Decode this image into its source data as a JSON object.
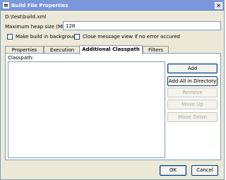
{
  "window": {
    "title": "Build File Properties",
    "close_symbol": "×"
  },
  "build_file": {
    "path": "D:\\test\\build.xml"
  },
  "heap": {
    "label": "Maximum heap size (Mb):",
    "value": "128"
  },
  "options": {
    "background_label": "Make build in background",
    "close_message_label": "Close message view if no error occured",
    "background_checked": false,
    "close_message_checked": false
  },
  "tabs": [
    {
      "label": "Properties"
    },
    {
      "label": "Execution"
    },
    {
      "label": "Additional Classpath"
    },
    {
      "label": "Filters"
    }
  ],
  "active_tab": "Additional Classpath",
  "classpath": {
    "label": "Classpath:",
    "items": []
  },
  "side_buttons": {
    "add": "Add",
    "add_all": "Add All in Directory",
    "remove": "Remove",
    "move_up": "Move Up",
    "move_down": "Move Down"
  },
  "footer": {
    "ok": "OK",
    "cancel": "Cancel"
  },
  "colors": {
    "titlebar": "#7a96df",
    "window_bg": "#ece9d8",
    "border": "#7f9db9"
  }
}
